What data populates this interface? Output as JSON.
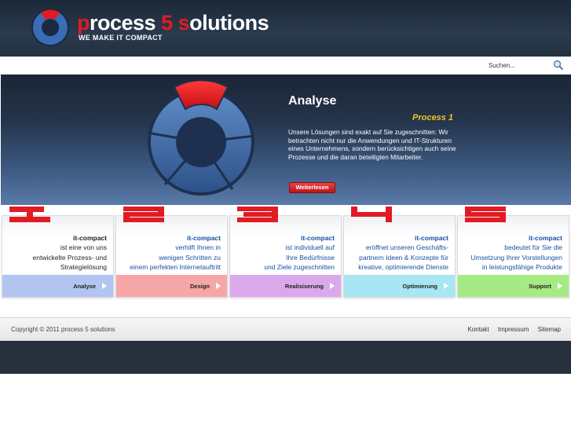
{
  "brand": {
    "name_part1": "p",
    "name_part2": "rocess ",
    "name_part3": "5",
    "name_part4": " ",
    "name_part5": "s",
    "name_part6": "olutions",
    "tagline": "WE MAKE IT COMPACT"
  },
  "search": {
    "placeholder": "Suchen...",
    "icon": "magnifier-icon"
  },
  "hero": {
    "title": "Analyse",
    "subtitle": "Process 1",
    "text": "Unsere Lösungen sind exakt auf Sie zugeschnitten: Wir betrachten nicht nur die Anwendungen und IT-Strukturen eines Unternehmens, sondern berücksichtigen auch seine Prozesse und die daran beteiligten Mitarbeiter.",
    "button": "Weiterlesen"
  },
  "steps": [
    {
      "number": "1",
      "title": "it-compact",
      "line1": "ist eine von uns",
      "line2": "entwickelte Prozess- und",
      "line3": "Strategielösung",
      "label": "Analyse",
      "color": "#b2c4f0"
    },
    {
      "number": "2",
      "title": "it-compact",
      "line1": "verhilft Ihnen in",
      "line2": "wenigen Schritten zu",
      "line3": "einem perfekten Internetauftritt",
      "label": "Design",
      "color": "#f6a6a6"
    },
    {
      "number": "3",
      "title": "it-compact",
      "line1": "ist individuell auf",
      "line2": "Ihre Bedürfnisse",
      "line3": "und Ziele zugeschnitten",
      "label": "Realisiserung",
      "color": "#dca8ec"
    },
    {
      "number": "4",
      "title": "it-compact",
      "line1": "eröffnet unseren Geschäfts-",
      "line2": "partnern Ideen & Konzepte für",
      "line3": "kreative, optimierende Dienste",
      "label": "Optimierung",
      "color": "#a8e6f4"
    },
    {
      "number": "5",
      "title": "it-compact",
      "line1": "bedeutet für Sie die",
      "line2": "Umsetzung Ihrer Vorstellungen",
      "line3": "in leistungsfähige Produkte",
      "label": "Support",
      "color": "#a6ea84"
    }
  ],
  "footer": {
    "copyright": "Copyright © 2011 process 5 solutions",
    "links": [
      "Kontakt",
      "Impressum",
      "Sitemap"
    ]
  },
  "colors": {
    "accent_red": "#e21b23",
    "header_dark": "#1c2838",
    "subtitle_yellow": "#f3c323"
  }
}
